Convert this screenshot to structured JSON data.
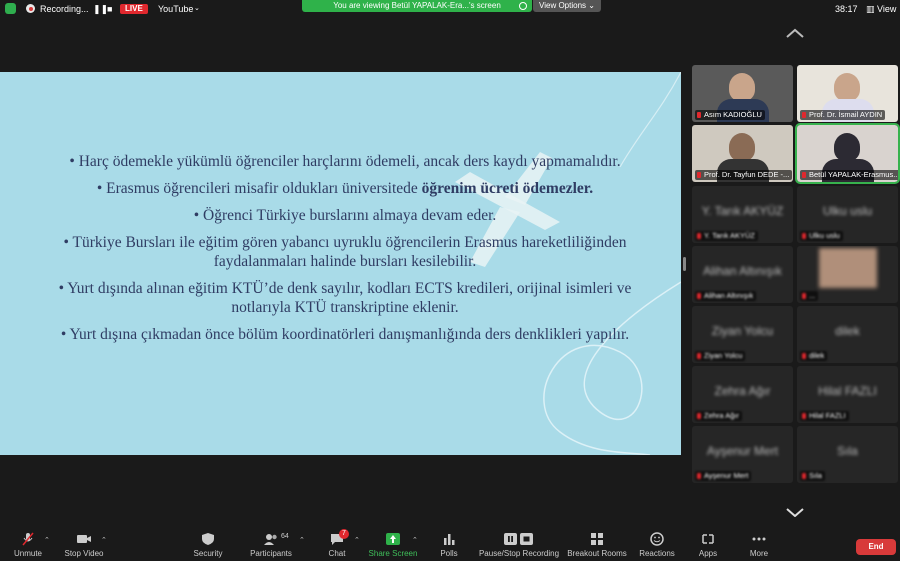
{
  "topbar": {
    "recording": "Recording...",
    "live": "LIVE",
    "youtube": "YouTube",
    "banner": "You are viewing Betül YAPALAK-Era...'s screen",
    "view_options": "View Options",
    "timer": "38:17",
    "view": "View"
  },
  "slide": {
    "bullets": [
      "• Harç ödemekle yükümlü öğrenciler harçlarını ödemeli, ancak ders kaydı yapmamalıdır.",
      "• Erasmus öğrencileri misafir oldukları üniversitede",
      "öğrenim ücreti ödemezler.",
      "• Öğrenci Türkiye burslarını almaya devam eder.",
      "• Türkiye Bursları ile eğitim gören yabancı uyruklu öğrencilerin Erasmus hareketliliğinden faydalanmaları halinde bursları kesilebilir.",
      "• Yurt dışında alınan eğitim KTÜ’de denk sayılır, kodları ECTS kredileri, orijinal isimleri ve notlarıyla KTÜ transkriptine eklenir.",
      "• Yurt dışına çıkmadan önce bölüm koordinatörleri danışmanlığında ders denklikleri yapılır."
    ]
  },
  "participants": [
    {
      "name": "Asım KADIOĞLU",
      "video": true
    },
    {
      "name": "Prof. Dr. İsmail AYDIN",
      "video": true
    },
    {
      "name": "Prof. Dr. Tayfun DEDE -...",
      "video": true
    },
    {
      "name": "Betül YAPALAK-Erasmus...",
      "video": true,
      "active": true
    },
    {
      "name": "Y. Tarık AKYÜZ",
      "big": "Y. Tarık AKYÜZ"
    },
    {
      "name": "Ulku uslu",
      "big": "Ulku uslu"
    },
    {
      "name": "Alihan Altınışık",
      "big": "Alihan Altınışık"
    },
    {
      "name": "...",
      "big": ""
    },
    {
      "name": "Ziyan Yolcu",
      "big": "Ziyan Yolcu"
    },
    {
      "name": "dilek",
      "big": "dilek"
    },
    {
      "name": "Zehra Ağır",
      "big": "Zehra Ağır"
    },
    {
      "name": "Hilal FAZLI",
      "big": "Hilal FAZLI"
    },
    {
      "name": "Ayşenur Mert",
      "big": "Ayşenur Mert"
    },
    {
      "name": "Sıla",
      "big": "Sıla"
    }
  ],
  "toolbar": {
    "unmute": "Unmute",
    "stop_video": "Stop Video",
    "security": "Security",
    "participants": "Participants",
    "participants_count": "64",
    "chat": "Chat",
    "chat_badge": "7",
    "share_screen": "Share Screen",
    "polls": "Polls",
    "pause_recording": "Pause/Stop Recording",
    "breakout": "Breakout Rooms",
    "reactions": "Reactions",
    "apps": "Apps",
    "more": "More",
    "end": "End"
  }
}
